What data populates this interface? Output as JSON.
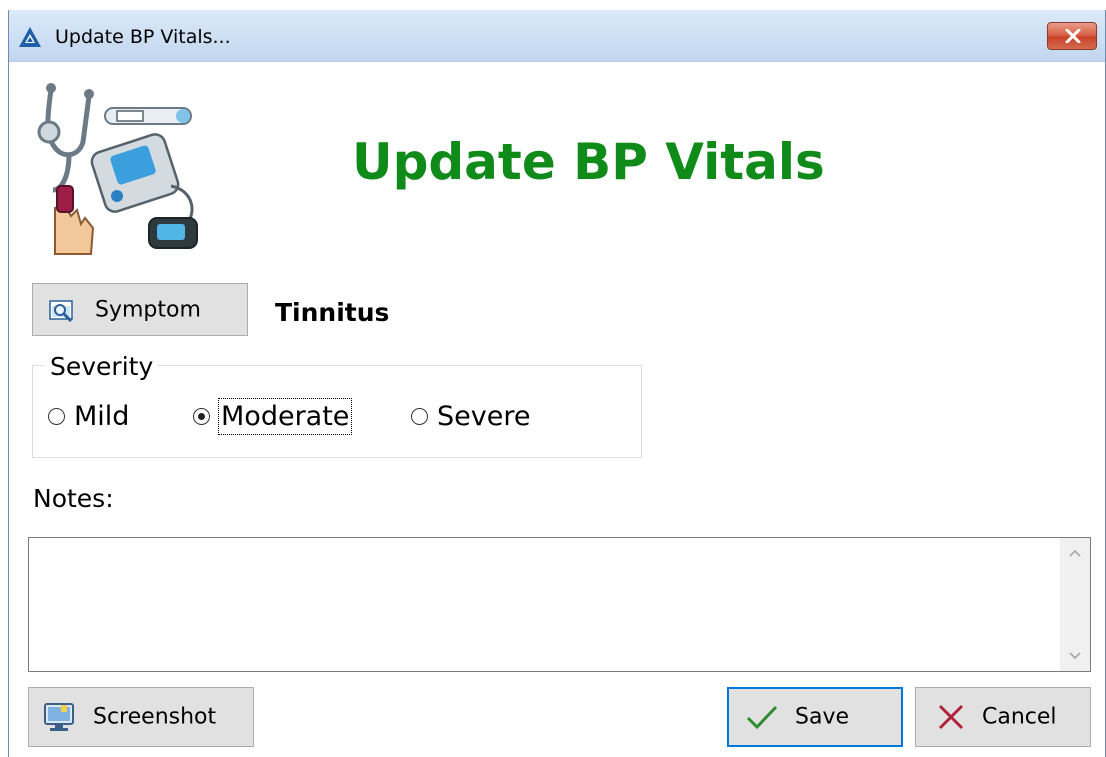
{
  "window": {
    "title": "Update BP Vitals..."
  },
  "header": {
    "title": "Update BP Vitals"
  },
  "symptom": {
    "button_label": "Symptom",
    "value": "Tinnitus"
  },
  "severity": {
    "legend": "Severity",
    "options": [
      "Mild",
      "Moderate",
      "Severe"
    ],
    "selected": "Moderate"
  },
  "notes": {
    "label": "Notes:",
    "value": ""
  },
  "buttons": {
    "screenshot": "Screenshot",
    "save": "Save",
    "cancel": "Cancel"
  },
  "colors": {
    "header_title": "#108a19",
    "save_focus_border": "#0078d7",
    "close_button": "#c7442b",
    "check_icon": "#2e8b2e",
    "cancel_icon": "#b0213a"
  },
  "icons": {
    "app": "app-logo-icon",
    "close": "close-icon",
    "header": "medical-devices-icon",
    "symptom": "symptom-search-icon",
    "screenshot": "monitor-icon",
    "save": "check-icon",
    "cancel": "x-icon"
  }
}
